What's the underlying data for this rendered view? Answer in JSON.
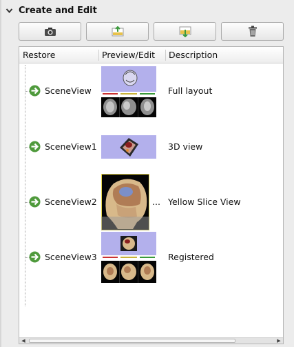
{
  "section": {
    "title": "Create and Edit",
    "expanded": true
  },
  "toolbar": {
    "buttons": [
      {
        "icon": "camera-icon"
      },
      {
        "icon": "edit-scene-icon"
      },
      {
        "icon": "restore-scene-icon"
      },
      {
        "icon": "trash-icon"
      }
    ]
  },
  "table": {
    "columns": [
      "Restore",
      "Preview/Edit",
      "Description"
    ],
    "rows": [
      {
        "name": "SceneView",
        "description": "Full layout",
        "preview_kind": "full-layout",
        "truncated": false
      },
      {
        "name": "SceneView1",
        "description": "3D view",
        "preview_kind": "3d-view",
        "truncated": false
      },
      {
        "name": "SceneView2",
        "description": "Yellow Slice View",
        "preview_kind": "yellow-slice",
        "truncated": true,
        "truncation_text": "..."
      },
      {
        "name": "SceneView3",
        "description": "Registered",
        "preview_kind": "registered",
        "truncated": false
      }
    ]
  },
  "colors": {
    "restore_arrow": "#4f9a3c",
    "view_lavender": "#b3b0ec",
    "slice_yellow": "#e9d84a"
  }
}
